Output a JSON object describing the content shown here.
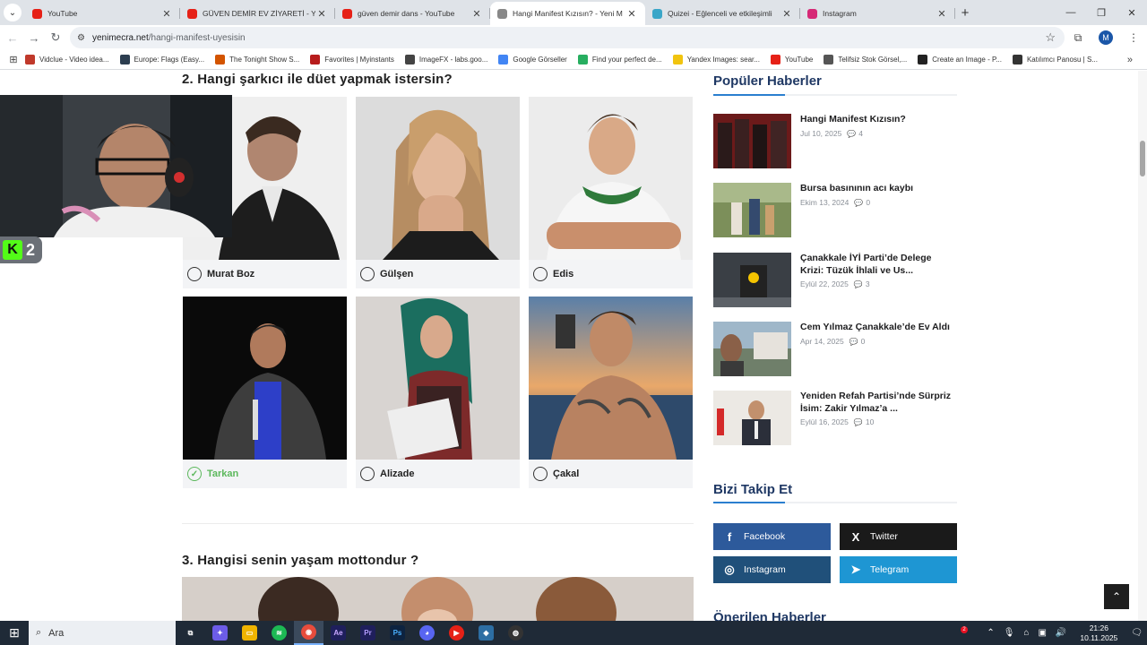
{
  "browser": {
    "tabs": [
      {
        "title": "YouTube",
        "icon": "youtube-icon",
        "color": "#e62117",
        "active": false
      },
      {
        "title": "GÜVEN DEMİR EV ZİYARETİ - Yo",
        "icon": "youtube-icon",
        "color": "#e62117",
        "active": false
      },
      {
        "title": "güven demir dans - YouTube",
        "icon": "youtube-icon",
        "color": "#e62117",
        "active": false
      },
      {
        "title": "Hangi Manifest Kızısın? - Yeni M",
        "icon": "page-icon",
        "color": "#888888",
        "active": true
      },
      {
        "title": "Quizei - Eğlenceli ve etkileşimli",
        "icon": "quizei-icon",
        "color": "#3aa6c8",
        "active": false
      },
      {
        "title": "Instagram",
        "icon": "instagram-icon",
        "color": "#d62976",
        "active": false
      }
    ],
    "url_host": "yenimecra.net",
    "url_path": "/hangi-manifest-uyesisin",
    "profile_initial": "M",
    "bookmarks": [
      {
        "label": "Vidclue - Video idea...",
        "color": "#c0392b"
      },
      {
        "label": "Europe: Flags (Easy...",
        "color": "#2c3e50"
      },
      {
        "label": "The Tonight Show S...",
        "color": "#d35400"
      },
      {
        "label": "Favorites | Myinstants",
        "color": "#b71c1c"
      },
      {
        "label": "ImageFX - labs.goo...",
        "color": "#444444"
      },
      {
        "label": "Google Görseller",
        "color": "#4285f4"
      },
      {
        "label": "Find your perfect de...",
        "color": "#27ae60"
      },
      {
        "label": "Yandex Images: sear...",
        "color": "#f1c40f"
      },
      {
        "label": "YouTube",
        "color": "#e62117"
      },
      {
        "label": "Telifsiz Stok Görsel,...",
        "color": "#555555"
      },
      {
        "label": "Create an Image - P...",
        "color": "#222222"
      },
      {
        "label": "Katılımcı Panosu | S...",
        "color": "#333333"
      }
    ]
  },
  "quiz": {
    "question2": "2. Hangi şarkıcı ile düet yapmak istersin?",
    "options": [
      {
        "label": "Murat Boz",
        "correct": false
      },
      {
        "label": "Gülşen",
        "correct": false
      },
      {
        "label": "Edis",
        "correct": false
      },
      {
        "label": "Tarkan",
        "correct": true
      },
      {
        "label": "Alizade",
        "correct": false
      },
      {
        "label": "Çakal",
        "correct": false
      }
    ],
    "question3": "3. Hangisi senin yaşam mottondur ?"
  },
  "sidebar": {
    "popular_title": "Popüler Haberler",
    "news": [
      {
        "title": "Hangi Manifest Kızısın?",
        "date": "Jul 10, 2025",
        "comments": "4"
      },
      {
        "title": "Bursa basınının acı kaybı",
        "date": "Ekim 13, 2024",
        "comments": "0"
      },
      {
        "title": "Çanakkale İYİ Parti’de Delege Krizi: Tüzük İhlali ve Us...",
        "date": "Eylül 22, 2025",
        "comments": "3"
      },
      {
        "title": "Cem Yılmaz Çanakkale’de Ev Aldı",
        "date": "Apr 14, 2025",
        "comments": "0"
      },
      {
        "title": "Yeniden Refah Partisi’nde Sürpriz İsim: Zakir Yılmaz’a ...",
        "date": "Eylül 16, 2025",
        "comments": "10"
      }
    ],
    "follow_title": "Bizi Takip Et",
    "social": [
      {
        "label": "Facebook",
        "glyph": "f",
        "color": "#2d5a9b"
      },
      {
        "label": "Twitter",
        "glyph": "X",
        "color": "#1a1a1a"
      },
      {
        "label": "Instagram",
        "glyph": "◎",
        "color": "#20507a"
      },
      {
        "label": "Telegram",
        "glyph": "➤",
        "color": "#1e96d3"
      }
    ],
    "recommended_title": "Önerilen Haberler"
  },
  "overlay": {
    "kick_letter": "K",
    "kick_count": "2"
  },
  "taskbar": {
    "search_placeholder": "Ara",
    "time": "21:26",
    "date": "10.11.2025",
    "notifications": "2"
  }
}
